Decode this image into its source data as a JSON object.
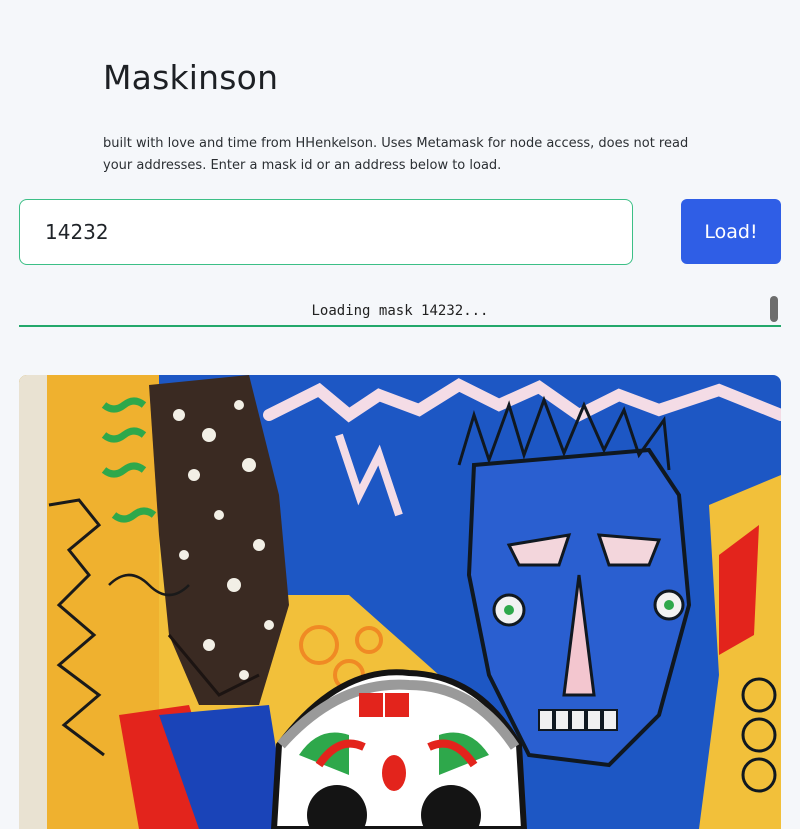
{
  "header": {
    "title": "Maskinson",
    "description": "built with love and time from HHenkelson. Uses Metamask for node access, does not read your addresses. Enter a mask id or an address below to load."
  },
  "search": {
    "value": "14232",
    "button_label": "Load!"
  },
  "status": {
    "message": "Loading mask 14232..."
  },
  "image": {
    "subject": "mask-artwork",
    "colors": {
      "blue": "#1d57c4",
      "yellow": "#f2c03a",
      "red": "#e3241c",
      "green": "#2ea84b",
      "accent_button": "#2f5ee6",
      "accent_border": "#3cbf86"
    }
  }
}
